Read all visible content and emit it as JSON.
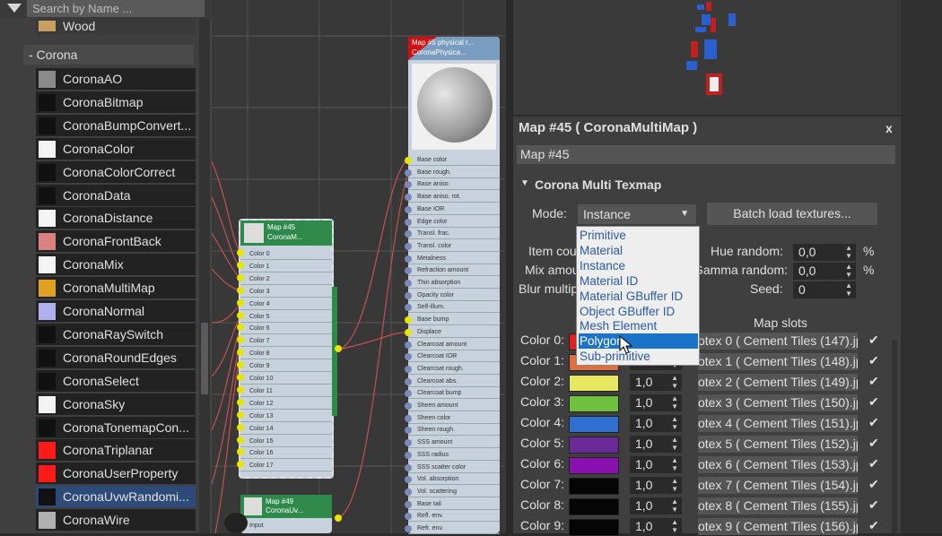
{
  "browser": {
    "search_placeholder": "Search by Name ...",
    "partial_item": "Wood",
    "category": "- Corona",
    "items": [
      {
        "label": "CoronaAO",
        "swatch": "#8a8a8a"
      },
      {
        "label": "CoronaBitmap",
        "swatch": "#111111"
      },
      {
        "label": "CoronaBumpConvert...",
        "swatch": "#111111"
      },
      {
        "label": "CoronaColor",
        "swatch": "#f4f4f4"
      },
      {
        "label": "CoronaColorCorrect",
        "swatch": "#111111"
      },
      {
        "label": "CoronaData",
        "swatch": "#111111"
      },
      {
        "label": "CoronaDistance",
        "swatch": "#f4f4f4"
      },
      {
        "label": "CoronaFrontBack",
        "swatch": "#d98080"
      },
      {
        "label": "CoronaMix",
        "swatch": "#f4f4f4"
      },
      {
        "label": "CoronaMultiMap",
        "swatch": "#e0a020"
      },
      {
        "label": "CoronaNormal",
        "swatch": "#b0b0f0"
      },
      {
        "label": "CoronaRaySwitch",
        "swatch": "#111111"
      },
      {
        "label": "CoronaRoundEdges",
        "swatch": "#111111"
      },
      {
        "label": "CoronaSelect",
        "swatch": "#111111"
      },
      {
        "label": "CoronaSky",
        "swatch": "#f4f4f4"
      },
      {
        "label": "CoronaTonemapCon...",
        "swatch": "#111111"
      },
      {
        "label": "CoronaTriplanar",
        "swatch": "#ff1a1a"
      },
      {
        "label": "CoronaUserProperty",
        "swatch": "#ff1a1a"
      },
      {
        "label": "CoronaUvwRandomi...",
        "swatch": "#111111"
      },
      {
        "label": "CoronaWire",
        "swatch": "#b0b0b0"
      }
    ]
  },
  "nodes": {
    "material_title": "Map #5 physical r...",
    "material_subtitle": "CoronaPhysica...",
    "material_slots": [
      "Base color",
      "Base rough.",
      "Base aniso.",
      "Base aniso. rot.",
      "Base IOR",
      "Edge color",
      "Transl. frac.",
      "Transl. color",
      "Metalness",
      "Refraction amount",
      "Thin absorption",
      "Opacity color",
      "Self-illum.",
      "Base bump",
      "Displace",
      "Clearcoat amount",
      "Clearcoat IOR",
      "Clearcoat rough.",
      "Clearcoat abs.",
      "Clearcoat bump",
      "Sheen amount",
      "Sheen color",
      "Sheen rough.",
      "SSS amount",
      "SSS radius",
      "SSS scatter color",
      "Vol. absorption",
      "Vol. scattering",
      "Base tail",
      "Refl. env.",
      "Refr. env."
    ],
    "multimap_title": "Map #45",
    "multimap_subtitle": "CoronaM...",
    "multimap_slots": [
      "Color 0",
      "Color 1",
      "Color 2",
      "Color 3",
      "Color 4",
      "Color 5",
      "Color 6",
      "Color 7",
      "Color 8",
      "Color 9",
      "Color 10",
      "Color 11",
      "Color 12",
      "Color 13",
      "Color 14",
      "Color 15",
      "Color 16",
      "Color 17"
    ],
    "uvw_title": "Map #49",
    "uvw_subtitle": "CoronaUv...",
    "uvw_slot": "Input"
  },
  "panel": {
    "title": "Map #45  ( CoronaMultiMap )",
    "close": "x",
    "name_field": "Map #45",
    "rollout": "Corona Multi Texmap",
    "mode_label": "Mode:",
    "mode_value": "Instance",
    "batch_button": "Batch load textures...",
    "item_count_label": "Item cou",
    "mix_amount_label": "Mix amou",
    "blur_label": "Blur multip",
    "hue_label": "Hue random:",
    "hue_value": "0,0",
    "gamma_label": "Gamma random:",
    "gamma_value": "0,0",
    "seed_label": "Seed:",
    "seed_value": "0",
    "percent": "%",
    "map_slots_label": "Map slots",
    "dropdown_options": [
      "Primitive",
      "Material",
      "Instance",
      "Material ID",
      "Material GBuffer ID",
      "Object GBuffer ID",
      "Mesh Element",
      "Polygon",
      "Sub-primitive"
    ],
    "dropdown_selected": "Polygon",
    "rows": [
      {
        "label": "Color 0:",
        "color": "#e02020",
        "amount": "",
        "tex": "otex 0 ( Cement Tiles (147).jp"
      },
      {
        "label": "Color 1:",
        "color": "#e07040",
        "amount": "",
        "tex": "otex 1 ( Cement Tiles (148).jp"
      },
      {
        "label": "Color 2:",
        "color": "#e8e860",
        "amount": "1,0",
        "tex": "otex 2 ( Cement Tiles (149).jp"
      },
      {
        "label": "Color 3:",
        "color": "#70c040",
        "amount": "1,0",
        "tex": "otex 3 ( Cement Tiles (150).jp"
      },
      {
        "label": "Color 4:",
        "color": "#3070d0",
        "amount": "1,0",
        "tex": "otex 4 ( Cement Tiles (151).jp"
      },
      {
        "label": "Color 5:",
        "color": "#6a2a9a",
        "amount": "1,0",
        "tex": "otex 5 ( Cement Tiles (152).jp"
      },
      {
        "label": "Color 6:",
        "color": "#8a10b0",
        "amount": "1,0",
        "tex": "otex 6 ( Cement Tiles (153).jp"
      },
      {
        "label": "Color 7:",
        "color": "#050505",
        "amount": "1,0",
        "tex": "otex 7 ( Cement Tiles (154).jp"
      },
      {
        "label": "Color 8:",
        "color": "#050505",
        "amount": "1,0",
        "tex": "otex 8 ( Cement Tiles (155).jp"
      },
      {
        "label": "Color 9:",
        "color": "#050505",
        "amount": "1,0",
        "tex": "otex 9 ( Cement Tiles (156).jp"
      }
    ]
  }
}
